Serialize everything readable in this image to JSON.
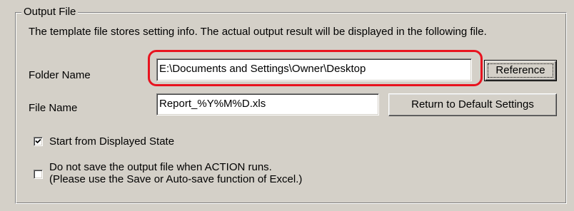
{
  "group": {
    "legend": "Output File",
    "description": "The template file stores setting info. The actual output result will be displayed in the following file."
  },
  "folder": {
    "label": "Folder Name",
    "value": "E:\\Documents and Settings\\Owner\\Desktop",
    "button_label": "Reference"
  },
  "file": {
    "label": "File Name",
    "value": "Report_%Y%M%D.xls",
    "button_label": "Return to Default Settings"
  },
  "options": {
    "start_displayed": {
      "label": "Start from Displayed State",
      "checked": true
    },
    "no_save": {
      "label_line1": "Do not save the output file when ACTION runs.",
      "label_line2": "(Please use the Save or Auto-save function of Excel.)",
      "checked": false
    }
  },
  "colors": {
    "background": "#d4d0c8",
    "highlight": "#e8131f"
  }
}
